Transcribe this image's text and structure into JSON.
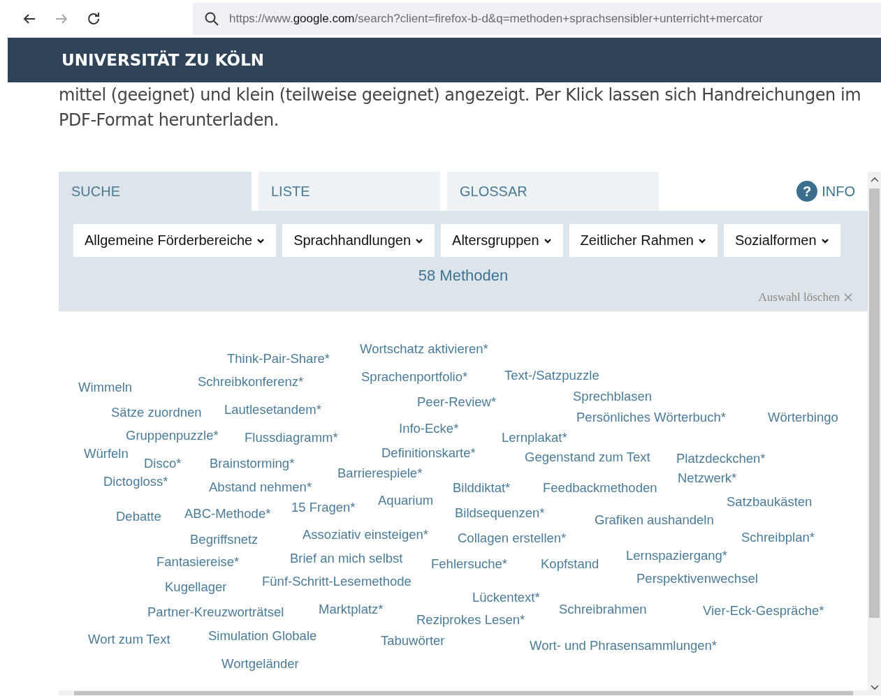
{
  "browser": {
    "nav": [
      {
        "kind": "back",
        "disabled": false
      },
      {
        "kind": "forward",
        "disabled": true
      },
      {
        "kind": "reload",
        "disabled": false
      }
    ],
    "url": {
      "prefix": "https://www.",
      "host": "google.com",
      "path": "/search?client=firefox-b-d&q=methoden+sprachsensibler+unterricht+mercator"
    }
  },
  "header": {
    "title": "UNIVERSITÄT ZU KÖLN"
  },
  "intro": "mittel (geeignet) und klein (teilweise geeignet) angezeigt. Per Klick lassen sich Handreichungen im PDF-Format herunterladen.",
  "tabs": [
    {
      "label": "SUCHE",
      "selected": true
    },
    {
      "label": "LISTE",
      "selected": false
    },
    {
      "label": "GLOSSAR",
      "selected": false
    }
  ],
  "info": {
    "icon": "?",
    "label": "INFO"
  },
  "filters": [
    "Allgemeine Förderbereiche",
    "Sprachhandlungen",
    "Altersgruppen",
    "Zeitlicher Rahmen",
    "Sozialformen"
  ],
  "count": "58 Methoden",
  "clear": "Auswahl löschen",
  "methods": [
    "Think-Pair-Share*",
    "Wortschatz aktivieren*",
    "Wimmeln",
    "Schreibkonferenz*",
    "Sprachenportfolio*",
    "Text-/Satzpuzzle",
    "Sätze zuordnen",
    "Lautlesetandem*",
    "Peer-Review*",
    "Sprechblasen",
    "Persönliches Wörterbuch*",
    "Wörterbingo",
    "Gruppenpuzzle*",
    "Flussdiagramm*",
    "Info-Ecke*",
    "Lernplakat*",
    "Würfeln",
    "Definitionskarte*",
    "Disco*",
    "Brainstorming*",
    "Gegenstand zum Text",
    "Platzdeckchen*",
    "Barrierespiele*",
    "Dictogloss*",
    "Netzwerk*",
    "Abstand nehmen*",
    "Bilddiktat*",
    "Feedbackmethoden",
    "Aquarium",
    "Satzbaukästen",
    "Debatte",
    "ABC-Methode*",
    "15 Fragen*",
    "Bildsequenzen*",
    "Grafiken aushandeln",
    "Assoziativ einsteigen*",
    "Begriffsnetz",
    "Collagen erstellen*",
    "Schreibplan*",
    "Fantasiereise*",
    "Brief an mich selbst",
    "Fehlersuche*",
    "Kopfstand",
    "Lernspaziergang*",
    "Perspektivenwechsel",
    "Kugellager",
    "Fünf-Schritt-Lesemethode",
    "Lückentext*",
    "Partner-Kreuzworträtsel",
    "Marktplatz*",
    "Schreibrahmen",
    "Vier-Eck-Gespräche*",
    "Reziprokes Lesen*",
    "Wort zum Text",
    "Simulation Globale",
    "Tabuwörter",
    "Wort- und Phrasensammlungen*",
    "Wortgeländer"
  ]
}
